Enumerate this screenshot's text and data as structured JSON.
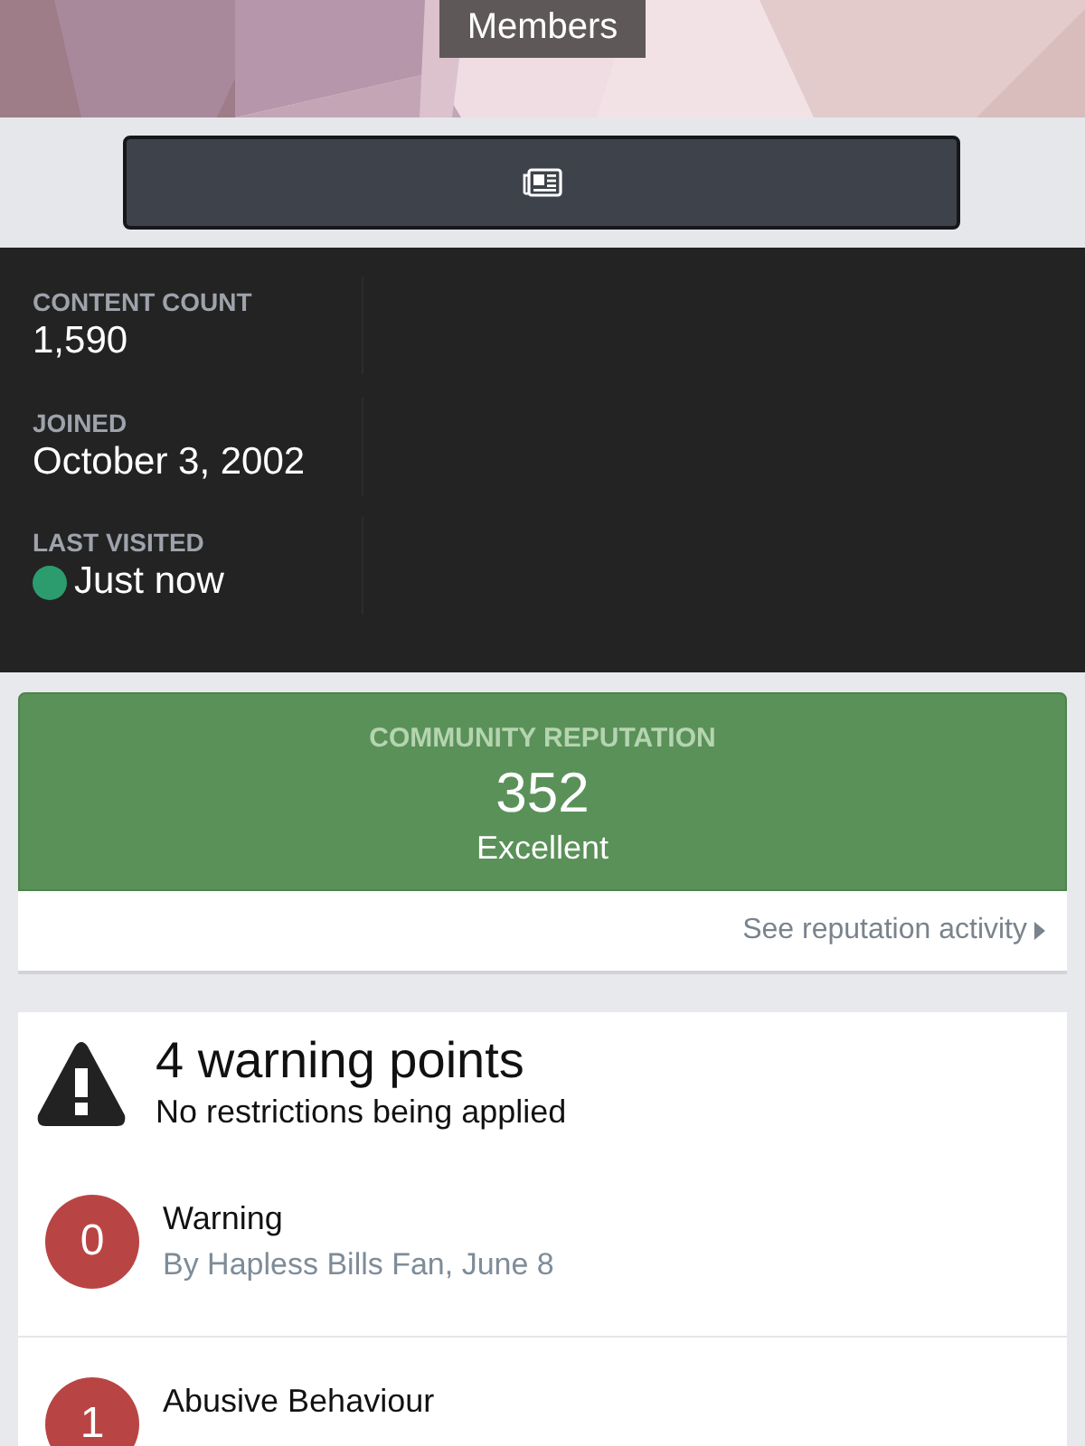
{
  "header": {
    "tab": "Members"
  },
  "stats": [
    {
      "label": "CONTENT COUNT",
      "value": "1,590",
      "online": false
    },
    {
      "label": "JOINED",
      "value": "October 3, 2002",
      "online": false
    },
    {
      "label": "LAST VISITED",
      "value": "Just now",
      "online": true
    }
  ],
  "reputation": {
    "label": "COMMUNITY REPUTATION",
    "score": "352",
    "rank": "Excellent",
    "link": "See reputation activity"
  },
  "warnings": {
    "title": "4 warning points",
    "subtitle": "No restrictions being applied",
    "items": [
      {
        "points": "0",
        "title": "Warning",
        "byline": "By Hapless Bills Fan, June 8"
      },
      {
        "points": "1",
        "title": "Abusive Behaviour"
      }
    ]
  }
}
